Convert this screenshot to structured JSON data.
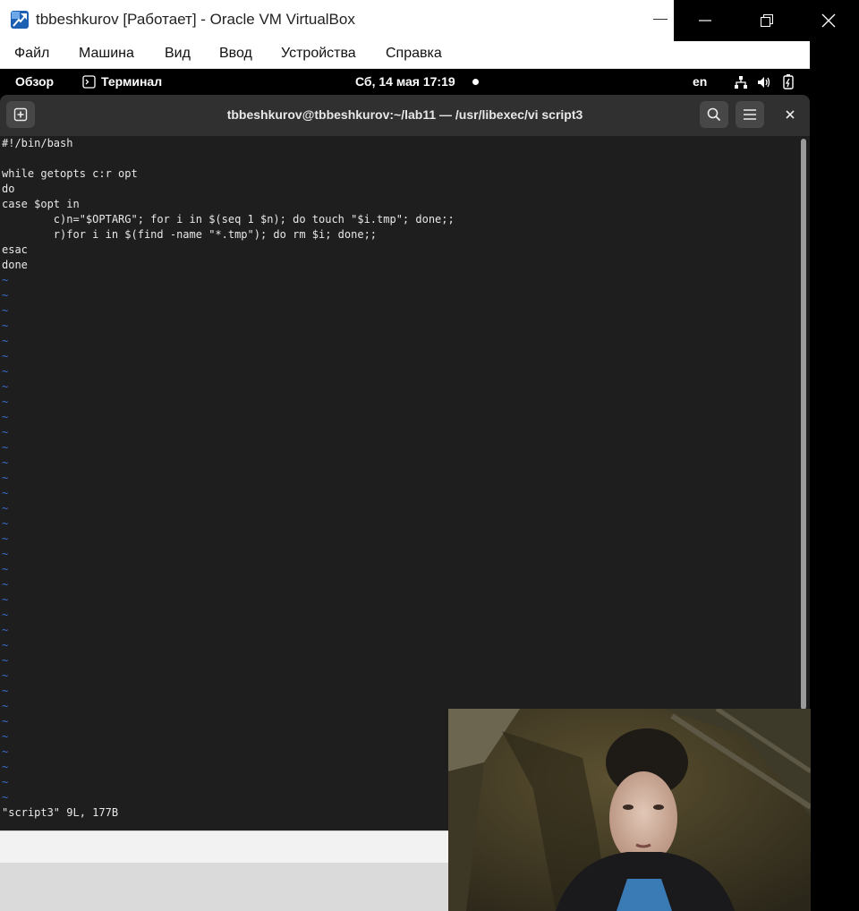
{
  "window": {
    "title": "tbbeshkurov [Работает] - Oracle VM VirtualBox",
    "icons": [
      "virtualbox-app-icon",
      "minimize-icon",
      "maximize-icon",
      "restore-icon",
      "close-icon"
    ]
  },
  "menu": [
    "Файл",
    "Машина",
    "Вид",
    "Ввод",
    "Устройства",
    "Справка"
  ],
  "gnome_bar": {
    "overview": "Обзор",
    "terminal": "Терминал",
    "datetime": "Сб, 14 мая  17:19",
    "lang": "en"
  },
  "terminal": {
    "title": "tbbeshkurov@tbbeshkurov:~/lab11 — /usr/libexec/vi script3",
    "lines": [
      "#!/bin/bash",
      "",
      "while getopts c:r opt",
      "do",
      "case $opt in",
      "        c)n=\"$OPTARG\"; for i in $(seq 1 $n); do touch \"$i.tmp\"; done;;",
      "        r)for i in $(find -name \"*.tmp\"); do rm $i; done;;",
      "esac",
      "done"
    ],
    "tilde": "~",
    "tilde_count": 35,
    "status": "\"script3\" 9L, 177B"
  },
  "colors": {
    "terminal_bg": "#1e1e1e",
    "header_bg": "#303030",
    "tilde": "#3a6fd1"
  }
}
